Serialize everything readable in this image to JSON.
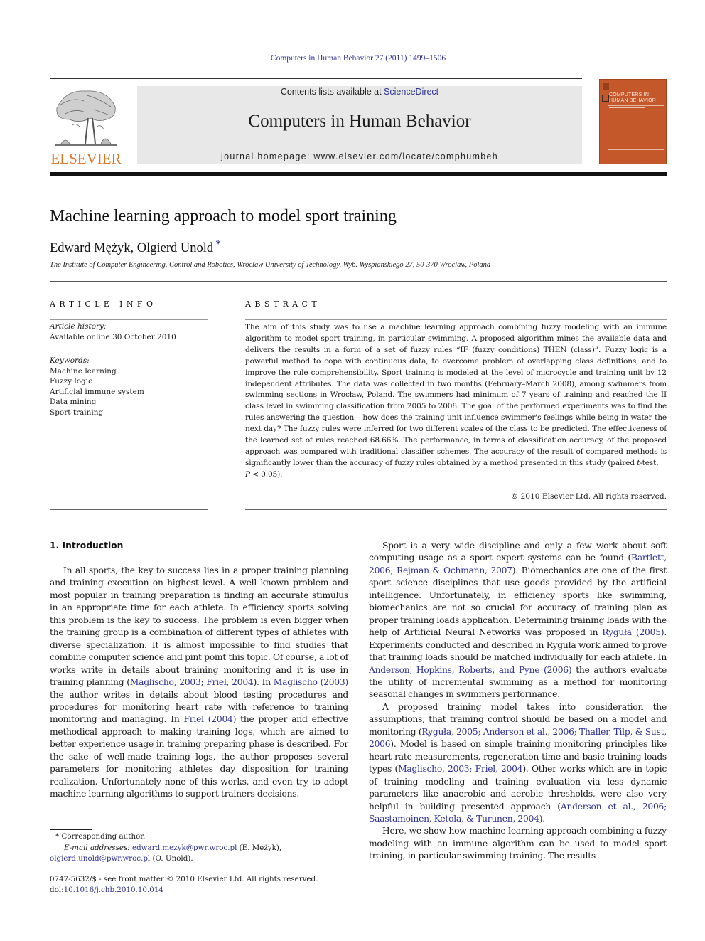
{
  "journal_citation": "Computers in Human Behavior 27 (2011) 1499–1506",
  "publisher": {
    "logo_word": "ELSEVIER",
    "logo_icon": "elsevier-tree-icon"
  },
  "banner": {
    "contents_prefix": "Contents lists available at ",
    "contents_link": "ScienceDirect",
    "journal_title": "Computers in Human Behavior",
    "homepage_prefix": "journal homepage: ",
    "homepage_url": "www.elsevier.com/locate/comphumbeh"
  },
  "cover": {
    "title_line1": "COMPUTERS IN",
    "title_line2": "HUMAN BEHAVIOR",
    "color": "#c5582a"
  },
  "article": {
    "title": "Machine learning approach to model sport training",
    "authors": "Edward Mężyk, Olgierd Unold",
    "corresponding_marker": "*",
    "affiliation": "The Institute of Computer Engineering, Control and Robotics, Wroclaw University of Technology, Wyb. Wyspianskiego 27, 50-370 Wroclaw, Poland"
  },
  "article_info": {
    "heading": "ARTICLE INFO",
    "history_label": "Article history:",
    "history_value": "Available online 30 October 2010",
    "keywords_label": "Keywords:",
    "keywords": [
      "Machine learning",
      "Fuzzy logic",
      "Artificial immune system",
      "Data mining",
      "Sport training"
    ]
  },
  "abstract": {
    "heading": "ABSTRACT",
    "text_before_t": "The aim of this study was to use a machine learning approach combining fuzzy modeling with an immune algorithm to model sport training, in particular swimming. A proposed algorithm mines the available data and delivers the results in a form of a set of fuzzy rules “IF (fuzzy conditions) THEN (class)”. Fuzzy logic is a powerful method to cope with continuous data, to overcome problem of overlapping class definitions, and to improve the rule comprehensibility. Sport training is modeled at the level of microcycle and training unit by 12 independent attributes. The data was collected in two months (February–March 2008), among swimmers from swimming sections in Wrocław, Poland. The swimmers had minimum of 7 years of training and reached the II class level in swimming classification from 2005 to 2008. The goal of the performed experiments was to find the rules answering the question – how does the training unit influence swimmer's feelings while being in water the next day? The fuzzy rules were inferred for two different scales of the class to be predicted. The effectiveness of the learned set of rules reached 68.66%. The performance, in terms of classification accuracy, of the proposed approach was compared with traditional classifier schemes. The accuracy of the result of compared methods is significantly lower than the accuracy of fuzzy rules obtained by a method presented in this study (paired ",
    "t_italic": "t",
    "text_mid": "-test, ",
    "p_italic": "P",
    "text_end": " < 0.05).",
    "copyright": "© 2010 Elsevier Ltd. All rights reserved."
  },
  "introduction": {
    "heading": "1. Introduction",
    "p1": [
      {
        "t": "In all sports, the key to success lies in a proper training planning and training execution on highest level. A well known problem and most popular in training preparation is finding an accurate stimulus in an appropriate time for each athlete. In efficiency sports solving this problem is the key to success. The problem is even bigger when the training group is a combination of different types of athletes with diverse specialization. It is almost impossible to find studies that combine computer science and pint point this topic. Of course, a lot of works write in details about training monitoring and it is use in training planning ("
      },
      {
        "t": "Maglischo, 2003; Friel, 2004",
        "link": true
      },
      {
        "t": "). In "
      },
      {
        "t": "Maglischo (2003)",
        "link": true
      },
      {
        "t": " the author writes in details about blood testing procedures and procedures for monitoring heart rate with reference to training monitoring and managing. In "
      },
      {
        "t": "Friel (2004)",
        "link": true
      },
      {
        "t": " the proper and effective methodical approach to making training logs, which are aimed to better experience usage in training preparing phase is described. For the sake of well-made training logs, the author proposes several parameters for monitoring athletes day disposition for training realization. Unfortunately none of this works, and even try to adopt machine learning algorithms to support trainers decisions."
      }
    ],
    "p2": [
      {
        "t": "Sport is a very wide discipline and only a few work about soft computing usage as a sport expert systems can be found ("
      },
      {
        "t": "Bartlett, 2006; Rejman & Ochmann, 2007",
        "link": true
      },
      {
        "t": "). Biomechanics are one of the first sport science disciplines that use goods provided by the artificial intelligence. Unfortunately, in efficiency sports like swimming, biomechanics are not so crucial for accuracy of training plan as proper training loads application. Determining training loads with the help of Artificial Neural Networks was proposed in "
      },
      {
        "t": "Ryguła (2005)",
        "link": true
      },
      {
        "t": ". Experiments conducted and described in Ryguła work aimed to prove that training loads should be matched individually for each athlete. In "
      },
      {
        "t": "Anderson, Hopkins, Roberts, and Pyne (2006)",
        "link": true
      },
      {
        "t": " the authors evaluate the utility of incremental swimming as a method for monitoring seasonal changes in swimmers performance."
      }
    ],
    "p3": [
      {
        "t": "A proposed training model takes into consideration the assumptions, that training control should be based on a model and monitoring ("
      },
      {
        "t": "Ryguła, 2005; Anderson et al., 2006; Thaller, Tilp, & Sust, 2006",
        "link": true
      },
      {
        "t": "). Model is based on simple training monitoring principles like heart rate measurements, regeneration time and basic training loads types ("
      },
      {
        "t": "Maglischo, 2003; Friel, 2004",
        "link": true
      },
      {
        "t": "). Other works which are in topic of training modeling and training evaluation via less dynamic parameters like anaerobic and aerobic thresholds, were also very helpful in building presented approach ("
      },
      {
        "t": "Anderson et al., 2006; Saastamoinen, Ketola, & Turunen, 2004",
        "link": true
      },
      {
        "t": ")."
      }
    ],
    "p4": [
      {
        "t": "Here, we show how machine learning approach combining a fuzzy modeling with an immune algorithm can be used to model sport training, in particular swimming training. The results"
      }
    ]
  },
  "footnote": {
    "marker": "*",
    "corresponding": "Corresponding author.",
    "email_label": "E-mail addresses:",
    "email1": "edward.mezyk@pwr.wroc.pl",
    "email1_name": " (E. Mężyk), ",
    "email2": "olgierd.unold@pwr.wroc.pl",
    "email2_name": " (O. Unold)."
  },
  "front_matter": {
    "issn_line": "0747-5632/$ - see front matter © 2010 Elsevier Ltd. All rights reserved.",
    "doi_prefix": "doi:",
    "doi": "10.1016/j.chb.2010.10.014"
  },
  "colors": {
    "link": "#2e3192",
    "elsevier_orange": "#e37222",
    "banner_bg": "#e8e8e8"
  }
}
